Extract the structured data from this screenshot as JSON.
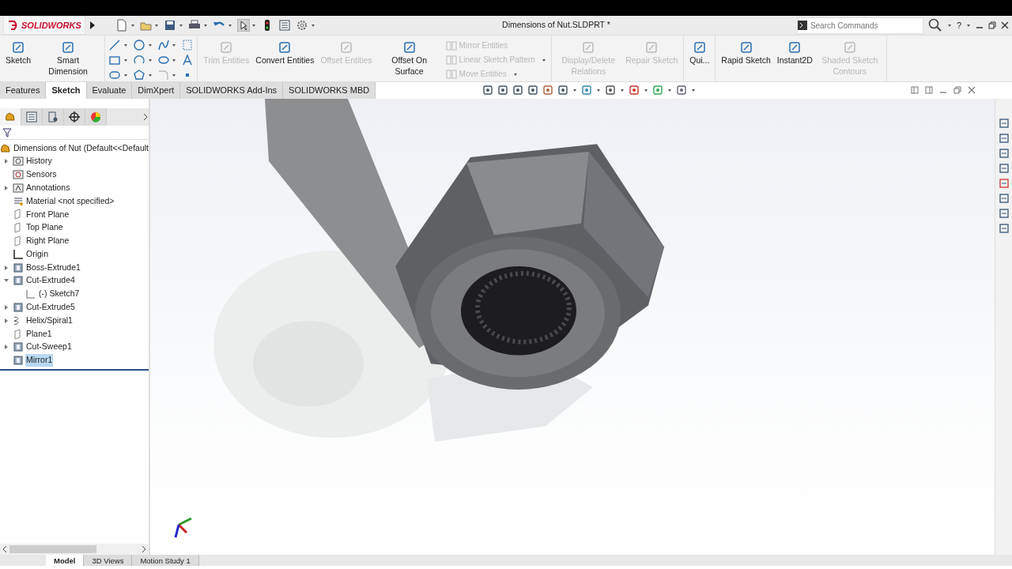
{
  "title_bar": {
    "app_name": "SOLIDWORKS",
    "document_title": "Dimensions of Nut.SLDPRT *",
    "search": {
      "placeholder": "Search Commands"
    },
    "help": "?"
  },
  "ribbon": {
    "groups": [
      {
        "kind": "buttons",
        "items": [
          {
            "label": "Sketch",
            "disabled": false
          },
          {
            "label": "Smart Dimension",
            "disabled": false
          }
        ]
      },
      {
        "kind": "sketch_tools"
      },
      {
        "kind": "buttons",
        "items": [
          {
            "label": "Trim Entities",
            "disabled": true
          },
          {
            "label": "Convert Entities",
            "disabled": false
          },
          {
            "label": "Offset Entities",
            "disabled": true
          },
          {
            "label": "Offset On Surface",
            "disabled": false
          }
        ],
        "list": [
          {
            "label": "Mirror Entities",
            "disabled": true,
            "dropdown": false
          },
          {
            "label": "Linear Sketch Pattern",
            "disabled": true,
            "dropdown": true
          },
          {
            "label": "Move Entities",
            "disabled": true,
            "dropdown": true
          }
        ]
      },
      {
        "kind": "buttons",
        "items": [
          {
            "label": "Display/Delete Relations",
            "disabled": true
          },
          {
            "label": "Repair Sketch",
            "disabled": true
          }
        ]
      },
      {
        "kind": "buttons",
        "items": [
          {
            "label": "Qui...",
            "disabled": false
          }
        ]
      },
      {
        "kind": "buttons",
        "items": [
          {
            "label": "Rapid Sketch",
            "disabled": false
          },
          {
            "label": "Instant2D",
            "disabled": false
          },
          {
            "label": "Shaded Sketch Contours",
            "disabled": true
          }
        ]
      }
    ]
  },
  "tabs": [
    {
      "label": "Features",
      "selected": false
    },
    {
      "label": "Sketch",
      "selected": true
    },
    {
      "label": "Evaluate",
      "selected": false
    },
    {
      "label": "DimXpert",
      "selected": false
    },
    {
      "label": "SOLIDWORKS Add-Ins",
      "selected": false
    },
    {
      "label": "SOLIDWORKS MBD",
      "selected": false
    }
  ],
  "feature_tree": {
    "root": "Dimensions of Nut  (Default<<Default",
    "items": [
      {
        "label": "History",
        "kind": "history",
        "expanded": false,
        "selected": false
      },
      {
        "label": "Sensors",
        "kind": "sensor",
        "selected": false
      },
      {
        "label": "Annotations",
        "kind": "annotation",
        "expanded": false,
        "selected": false
      },
      {
        "label": "Material <not specified>",
        "kind": "material",
        "selected": false
      },
      {
        "label": "Front Plane",
        "kind": "plane",
        "selected": false
      },
      {
        "label": "Top Plane",
        "kind": "plane",
        "selected": false
      },
      {
        "label": "Right Plane",
        "kind": "plane",
        "selected": false
      },
      {
        "label": "Origin",
        "kind": "origin",
        "selected": false
      },
      {
        "label": "Boss-Extrude1",
        "kind": "feature",
        "expanded": false,
        "selected": false
      },
      {
        "label": "Cut-Extrude4",
        "kind": "feature",
        "expanded": true,
        "selected": false,
        "children": [
          {
            "label": "(-) Sketch7",
            "kind": "sketch",
            "selected": false
          }
        ]
      },
      {
        "label": "Cut-Extrude5",
        "kind": "feature",
        "expanded": false,
        "selected": false
      },
      {
        "label": "Helix/Spiral1",
        "kind": "helix",
        "expanded": false,
        "selected": false
      },
      {
        "label": "Plane1",
        "kind": "plane",
        "selected": false
      },
      {
        "label": "Cut-Sweep1",
        "kind": "feature",
        "expanded": false,
        "selected": false
      },
      {
        "label": "Mirror1",
        "kind": "feature",
        "selected": true
      }
    ]
  },
  "bottom_tabs": [
    {
      "label": "Model",
      "selected": true
    },
    {
      "label": "3D Views",
      "selected": false
    },
    {
      "label": "Motion Study 1",
      "selected": false
    }
  ]
}
